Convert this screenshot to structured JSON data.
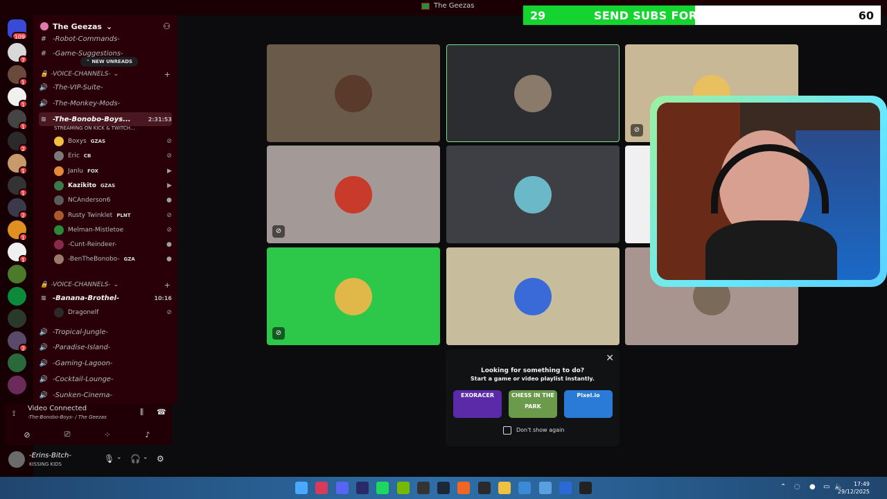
{
  "window": {
    "title": "The Geezas"
  },
  "rail": {
    "home_badge": "109",
    "servers": [
      {
        "badge": "7",
        "color": "#d8d8d8"
      },
      {
        "badge": "1",
        "color": "#6a4a3a"
      },
      {
        "badge": "1",
        "color": "#f0f0f0"
      },
      {
        "badge": "1",
        "color": "#444444"
      },
      {
        "badge": "2",
        "color": "#2a2a2a"
      },
      {
        "badge": "1",
        "color": "#c89a6a"
      },
      {
        "badge": "1",
        "color": "#333333"
      },
      {
        "badge": "2",
        "color": "#3a3a4a"
      },
      {
        "badge": "1",
        "color": "#e09020"
      },
      {
        "badge": "1",
        "color": "#f0f0f0"
      },
      {
        "badge": "",
        "color": "#4a7a2a"
      },
      {
        "badge": "",
        "color": "#0a8a3a"
      },
      {
        "badge": "",
        "color": "#2a3a2a"
      },
      {
        "badge": "2",
        "color": "#5a4a6a"
      },
      {
        "badge": "",
        "color": "#2a6a3a"
      },
      {
        "badge": "",
        "color": "#6a2a5a"
      }
    ]
  },
  "guild": {
    "name": "The Geezas"
  },
  "channels": {
    "top": [
      {
        "name": "-Robot-Commands-"
      },
      {
        "name": "-Game-Suggestions-"
      }
    ],
    "new_unreads": "NEW UNREADS",
    "cat1": "-VOICE-CHANNELS-",
    "vc1": [
      {
        "name": "-The-VIP-Suite-"
      },
      {
        "name": "-The-Monkey-Mods-"
      }
    ],
    "active": {
      "name": "-The-Bonobo-Boys...",
      "time": "2:31:53",
      "streaming": "STREAMING ON KICK & TWITCH..."
    },
    "members": [
      {
        "name": "Boxys",
        "tag": "GZAS",
        "color": "#f0c040"
      },
      {
        "name": "Eric",
        "tag": "CB",
        "color": "#7a7a7a"
      },
      {
        "name": "Janlu",
        "tag": "FOX",
        "color": "#e08a3a"
      },
      {
        "name": "Kazikito",
        "tag": "GZAS",
        "color": "#3a7a4a"
      },
      {
        "name": "NCAnderson6",
        "tag": "",
        "color": "#5a5a5a"
      },
      {
        "name": "Rusty Twinklet",
        "tag": "PLNT",
        "color": "#aa5a2a"
      },
      {
        "name": "Melman-Mistletoe",
        "tag": "",
        "color": "#2a8a3a"
      },
      {
        "name": "-Cunt-Reindeer-",
        "tag": "",
        "color": "#8a2a4a"
      },
      {
        "name": "-BenTheBonobo-",
        "tag": "GZA",
        "color": "#9a7a6a"
      }
    ],
    "cat2": "-VOICE-CHANNELS-",
    "vc2_active": {
      "name": "-Banana-Brothel-",
      "time": "10:16"
    },
    "vc2_member": {
      "name": "Dragonelf"
    },
    "vc3": [
      {
        "name": "-Tropical-Jungle-"
      },
      {
        "name": "-Paradise-Island-"
      },
      {
        "name": "-Gaming-Lagoon-"
      },
      {
        "name": "-Cocktail-Lounge-"
      },
      {
        "name": "-Sunken-Cinema-"
      }
    ]
  },
  "voice": {
    "status": "Video Connected",
    "location": "-The-Bonobo-Boys- / The Geezas"
  },
  "user": {
    "name": "-Erins-Bitch-",
    "status": "KISSING KIDS"
  },
  "tiles": [
    {
      "bg": "#6a5a4a",
      "muted": false,
      "highlight": false
    },
    {
      "bg": "#2b2d31",
      "muted": false,
      "highlight": true
    },
    {
      "bg": "#c8b896",
      "muted": true,
      "highlight": false
    },
    {
      "bg": "#a39a97",
      "muted": true,
      "highlight": false
    },
    {
      "bg": "#3e3f44",
      "muted": false,
      "highlight": false
    },
    {
      "bg": "#f0f0f0",
      "muted": false,
      "highlight": false
    },
    {
      "bg": "#2dc84a",
      "muted": true,
      "highlight": false
    },
    {
      "bg": "#c7bd9c",
      "muted": false,
      "highlight": false
    },
    {
      "bg": "#a89590",
      "muted": false,
      "highlight": false
    }
  ],
  "activity": {
    "title": "Looking for something to do?",
    "subtitle": "Start a game or video playlist instantly.",
    "cards": [
      {
        "label": "EXORACER",
        "color": "#5a2aa8"
      },
      {
        "label": "CHESS IN THE PARK",
        "color": "#6a9a4a"
      },
      {
        "label": "Pixel.io",
        "color": "#2a7ad8"
      }
    ],
    "checkbox_label": "Don't show again"
  },
  "sub_goal": {
    "current": "29",
    "goal": "60",
    "message": "SEND SUBS FOR DRUNK STREAM!",
    "progress": 0.48
  },
  "taskbar": {
    "time": "17:49",
    "date": "29/12/2025",
    "icons": [
      {
        "name": "windows-start-icon",
        "color": "#4aa8ff"
      },
      {
        "name": "opera-icon",
        "color": "#d83a5a"
      },
      {
        "name": "discord-icon",
        "color": "#5865f2"
      },
      {
        "name": "premiere-icon",
        "color": "#2a2a6a"
      },
      {
        "name": "spotify-icon",
        "color": "#1ed760"
      },
      {
        "name": "nvidia-icon",
        "color": "#76b900"
      },
      {
        "name": "obs-icon",
        "color": "#333333"
      },
      {
        "name": "steam-icon",
        "color": "#1b2838"
      },
      {
        "name": "origin-icon",
        "color": "#f26522"
      },
      {
        "name": "epic-games-icon",
        "color": "#2a2a2a"
      },
      {
        "name": "folder-icon",
        "color": "#f0c040"
      },
      {
        "name": "notepad-icon",
        "color": "#3a8ad8"
      },
      {
        "name": "paint-icon",
        "color": "#5aa0e0"
      },
      {
        "name": "game-icon",
        "color": "#2a6ad8"
      },
      {
        "name": "terminal-icon",
        "color": "#222222"
      }
    ]
  }
}
